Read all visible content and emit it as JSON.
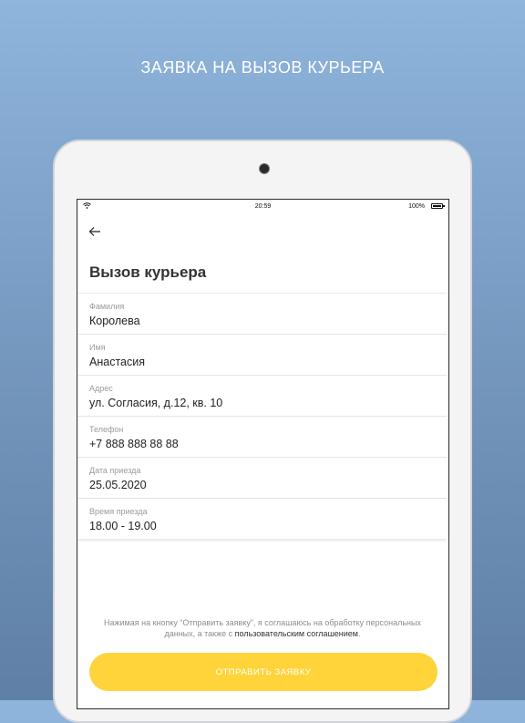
{
  "promo": {
    "title": "ЗАЯВКА НА ВЫЗОВ КУРЬЕРА"
  },
  "status_bar": {
    "time": "20:59",
    "battery": "100%"
  },
  "page": {
    "back_icon": "back-arrow-icon",
    "title": "Вызов курьера"
  },
  "form": {
    "fields": [
      {
        "label": "Фамилия",
        "value": "Королева"
      },
      {
        "label": "Имя",
        "value": "Анастасия"
      },
      {
        "label": "Адрес",
        "value": "ул. Согласия, д.12, кв. 10"
      },
      {
        "label": "Телефон",
        "value": "+7 888 888 88 88"
      },
      {
        "label": "Дата приезда",
        "value": "25.05.2020"
      },
      {
        "label": "Время приезда",
        "value": "18.00 - 19.00"
      }
    ]
  },
  "consent": {
    "text_before": "Нажимая на кнопку “Отправить заявку”, я соглашаюсь на обработку персональных данных, а также с ",
    "link": "пользовательским соглашением",
    "text_after": "."
  },
  "submit": {
    "label": "ОТПРАВИТЬ ЗАЯВКУ",
    "color": "#fed43a"
  }
}
